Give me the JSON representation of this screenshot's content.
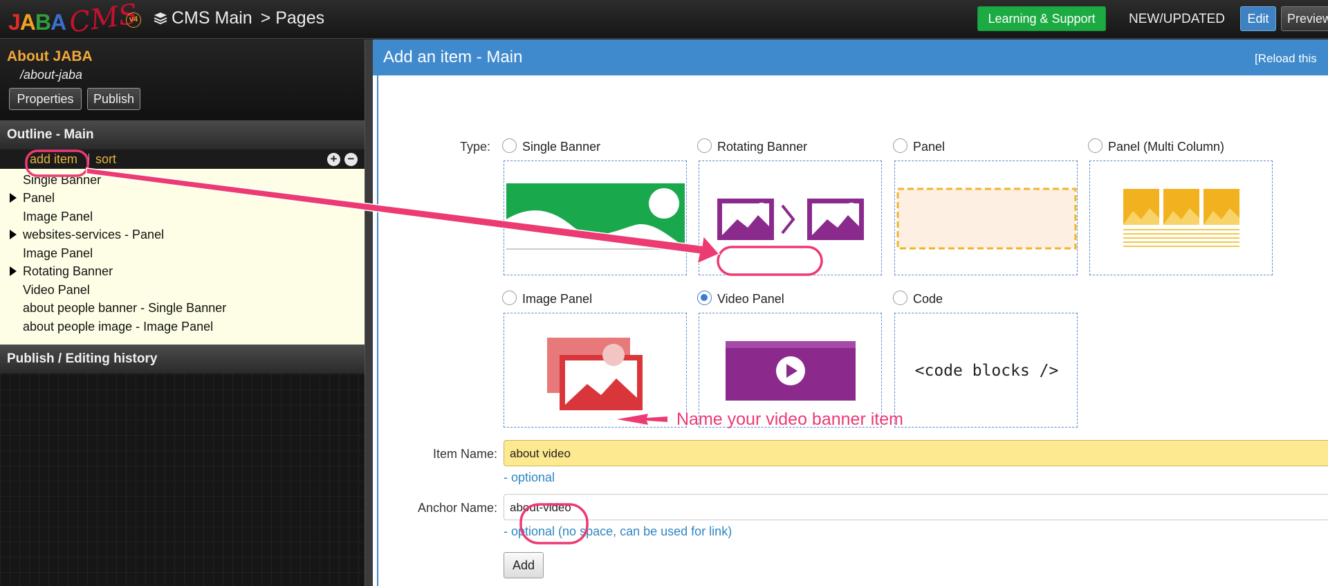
{
  "topbar": {
    "logo_text": "JABA",
    "logo_script": "CMS",
    "logo_badge": "v4",
    "breadcrumb_root": "CMS Main",
    "breadcrumb_current": "> Pages",
    "learning_label": "Learning & Support",
    "new_updated_label": "NEW/UPDATED",
    "edit_label": "Edit",
    "preview_label": "Preview"
  },
  "page": {
    "title": "About JABA",
    "url": "/about-jaba",
    "properties_label": "Properties",
    "publish_label": "Publish"
  },
  "outline": {
    "header": "Outline - Main",
    "add_item_label": "add item",
    "sort_label": "sort",
    "expand_icon": "plus-circle-icon",
    "collapse_icon": "minus-circle-icon",
    "items": [
      {
        "label": "Single Banner",
        "expandable": false
      },
      {
        "label": "Panel",
        "expandable": true
      },
      {
        "label": "Image Panel",
        "expandable": false
      },
      {
        "label": "websites-services - Panel",
        "expandable": true
      },
      {
        "label": "Image Panel",
        "expandable": false
      },
      {
        "label": "Rotating Banner",
        "expandable": true
      },
      {
        "label": "Video Panel",
        "expandable": false
      },
      {
        "label": "about people banner - Single Banner",
        "expandable": false
      },
      {
        "label": "about people image - Image Panel",
        "expandable": false
      }
    ]
  },
  "history": {
    "header": "Publish / Editing history"
  },
  "main": {
    "title": "Add an item - Main",
    "reload_label": "[Reload this",
    "type_label": "Type:",
    "selected_type": "Video Panel",
    "types": [
      {
        "label": "Single Banner",
        "selected": false
      },
      {
        "label": "Rotating Banner",
        "selected": false
      },
      {
        "label": "Panel",
        "selected": false
      },
      {
        "label": "Panel (Multi Column)",
        "selected": false
      },
      {
        "label": "Image Panel",
        "selected": false
      },
      {
        "label": "Video Panel",
        "selected": true
      },
      {
        "label": "Code",
        "selected": false
      }
    ],
    "code_tile_text": "<code blocks />",
    "item_name_label": "Item Name:",
    "item_name_value": "about video",
    "item_name_hint": "- optional",
    "anchor_label": "Anchor Name:",
    "anchor_value": "about-video",
    "anchor_hint": "- optional (no space, can be used for link)",
    "add_button_label": "Add"
  },
  "annotations": {
    "item_name_callout": "Name your video banner item"
  },
  "colors": {
    "accent_blue": "#3f89cd",
    "success_green": "#1cab42",
    "annotation_pink": "#ec3a72",
    "brand_orange": "#f2a93b"
  }
}
